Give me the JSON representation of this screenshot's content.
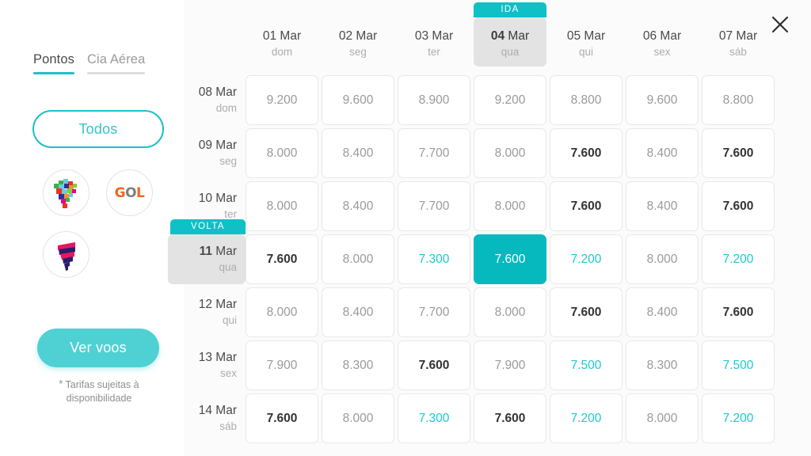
{
  "window": {
    "close_label": "✕"
  },
  "sidebar": {
    "tabs": [
      {
        "label": "Pontos",
        "active": true
      },
      {
        "label": "Cia Aérea",
        "active": false
      }
    ],
    "filter_all_label": "Todos",
    "airlines": [
      {
        "name": "latam",
        "label": "LATAM"
      },
      {
        "name": "gol",
        "label": "GOL"
      },
      {
        "name": "azul",
        "label": "Azul"
      }
    ],
    "cta_label": "Ver voos",
    "disclaimer_star": "*",
    "disclaimer_text": "Tarifas sujeitas à disponibilidade"
  },
  "calendar": {
    "outbound_badge": "IDA",
    "return_badge": "VOLTA",
    "columns": [
      {
        "date": "01 Mar",
        "weekday": "dom",
        "selected": false
      },
      {
        "date": "02 Mar",
        "weekday": "seg",
        "selected": false
      },
      {
        "date": "03 Mar",
        "weekday": "ter",
        "selected": false
      },
      {
        "date": "04 Mar",
        "weekday": "qua",
        "selected": true
      },
      {
        "date": "05 Mar",
        "weekday": "qui",
        "selected": false
      },
      {
        "date": "06 Mar",
        "weekday": "sex",
        "selected": false
      },
      {
        "date": "07 Mar",
        "weekday": "sáb",
        "selected": false
      }
    ],
    "rows": [
      {
        "date": "08 Mar",
        "weekday": "dom",
        "selected": false,
        "cells": [
          {
            "value": "9.200",
            "style": "normal"
          },
          {
            "value": "9.600",
            "style": "normal"
          },
          {
            "value": "8.900",
            "style": "normal"
          },
          {
            "value": "9.200",
            "style": "normal"
          },
          {
            "value": "8.800",
            "style": "normal"
          },
          {
            "value": "9.600",
            "style": "normal"
          },
          {
            "value": "8.800",
            "style": "normal"
          }
        ]
      },
      {
        "date": "09 Mar",
        "weekday": "seg",
        "selected": false,
        "cells": [
          {
            "value": "8.000",
            "style": "normal"
          },
          {
            "value": "8.400",
            "style": "normal"
          },
          {
            "value": "7.700",
            "style": "normal"
          },
          {
            "value": "8.000",
            "style": "normal"
          },
          {
            "value": "7.600",
            "style": "low"
          },
          {
            "value": "8.400",
            "style": "normal"
          },
          {
            "value": "7.600",
            "style": "low"
          }
        ]
      },
      {
        "date": "10 Mar",
        "weekday": "ter",
        "selected": false,
        "cells": [
          {
            "value": "8.000",
            "style": "normal"
          },
          {
            "value": "8.400",
            "style": "normal"
          },
          {
            "value": "7.700",
            "style": "normal"
          },
          {
            "value": "8.000",
            "style": "normal"
          },
          {
            "value": "7.600",
            "style": "low"
          },
          {
            "value": "8.400",
            "style": "normal"
          },
          {
            "value": "7.600",
            "style": "low"
          }
        ]
      },
      {
        "date": "11 Mar",
        "weekday": "qua",
        "selected": true,
        "cells": [
          {
            "value": "7.600",
            "style": "low"
          },
          {
            "value": "8.000",
            "style": "normal"
          },
          {
            "value": "7.300",
            "style": "best"
          },
          {
            "value": "7.600",
            "style": "selected"
          },
          {
            "value": "7.200",
            "style": "best"
          },
          {
            "value": "8.000",
            "style": "normal"
          },
          {
            "value": "7.200",
            "style": "best"
          }
        ]
      },
      {
        "date": "12 Mar",
        "weekday": "qui",
        "selected": false,
        "cells": [
          {
            "value": "8.000",
            "style": "normal"
          },
          {
            "value": "8.400",
            "style": "normal"
          },
          {
            "value": "7.700",
            "style": "normal"
          },
          {
            "value": "8.000",
            "style": "normal"
          },
          {
            "value": "7.600",
            "style": "low"
          },
          {
            "value": "8.400",
            "style": "normal"
          },
          {
            "value": "7.600",
            "style": "low"
          }
        ]
      },
      {
        "date": "13 Mar",
        "weekday": "sex",
        "selected": false,
        "cells": [
          {
            "value": "7.900",
            "style": "normal"
          },
          {
            "value": "8.300",
            "style": "normal"
          },
          {
            "value": "7.600",
            "style": "low"
          },
          {
            "value": "7.900",
            "style": "normal"
          },
          {
            "value": "7.500",
            "style": "best"
          },
          {
            "value": "8.300",
            "style": "normal"
          },
          {
            "value": "7.500",
            "style": "best"
          }
        ]
      },
      {
        "date": "14 Mar",
        "weekday": "sáb",
        "selected": false,
        "cells": [
          {
            "value": "7.600",
            "style": "low"
          },
          {
            "value": "8.000",
            "style": "normal"
          },
          {
            "value": "7.300",
            "style": "best"
          },
          {
            "value": "7.600",
            "style": "low"
          },
          {
            "value": "7.200",
            "style": "best"
          },
          {
            "value": "8.000",
            "style": "normal"
          },
          {
            "value": "7.200",
            "style": "best"
          }
        ]
      }
    ]
  },
  "colors": {
    "accent": "#0fc0c6",
    "accent_light": "#4fd1d4",
    "best_price": "#1ec8ce",
    "selected_bg": "#05b9bf",
    "neutral_text": "#9a9a9a",
    "low_text": "#333333",
    "selected_header_bg": "#e3e3e3"
  }
}
